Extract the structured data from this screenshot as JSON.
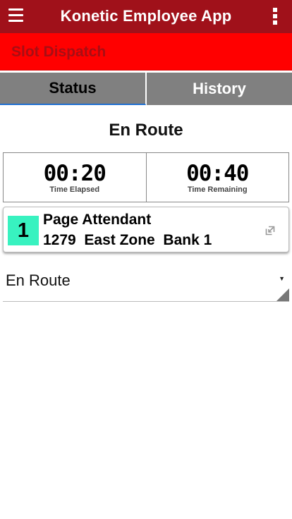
{
  "app_bar": {
    "title": "Konetic Employee App"
  },
  "section": {
    "title": "Slot Dispatch"
  },
  "tabs": [
    {
      "label": "Status",
      "active": true
    },
    {
      "label": "History",
      "active": false
    }
  ],
  "status": {
    "heading": "En Route"
  },
  "timers": {
    "elapsed": {
      "value": "00:20",
      "label": "Time Elapsed"
    },
    "remaining": {
      "value": "00:40",
      "label": "Time Remaining"
    }
  },
  "task": {
    "priority": "1",
    "title": "Page Attendant",
    "location": "1279  East Zone  Bank 1",
    "icon": "open-external-icon"
  },
  "status_select": {
    "value": "En Route"
  },
  "colors": {
    "app_bar": "#a0111a",
    "section_bar": "#ff0000",
    "section_text": "#a80e14",
    "tab_bg": "#808080",
    "active_tab_underline": "#1e6fd0",
    "priority_badge": "#38f2c0"
  }
}
